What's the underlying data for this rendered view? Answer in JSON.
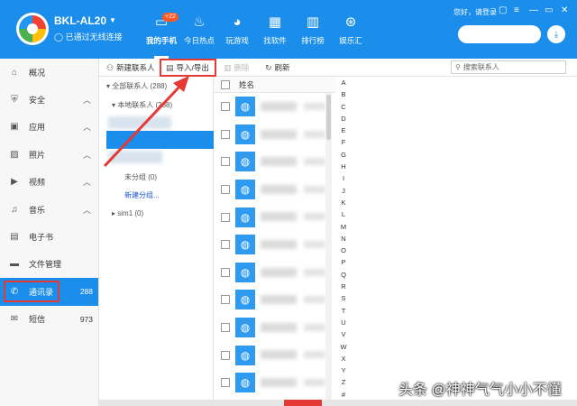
{
  "header": {
    "device_name": "BKL-AL20",
    "device_status": "◯ 已通过无线连接",
    "login_text": "您好，请登录",
    "nav": [
      {
        "label": "我的手机",
        "icon": "phone-icon",
        "badge": "+22"
      },
      {
        "label": "今日热点",
        "icon": "flame-icon"
      },
      {
        "label": "玩游戏",
        "icon": "gamepad-icon"
      },
      {
        "label": "找软件",
        "icon": "apps-grid-icon"
      },
      {
        "label": "排行榜",
        "icon": "bar-chart-icon"
      },
      {
        "label": "娱乐汇",
        "icon": "film-reel-icon"
      }
    ],
    "colors": {
      "primary": "#1a8eea",
      "badge": "#ff5722"
    }
  },
  "sidebar": {
    "items": [
      {
        "label": "概况",
        "icon": "home-icon"
      },
      {
        "label": "安全",
        "icon": "shield-icon",
        "expand": "︿"
      },
      {
        "label": "应用",
        "icon": "app-icon",
        "expand": "︿"
      },
      {
        "label": "照片",
        "icon": "photo-icon",
        "expand": "︿"
      },
      {
        "label": "视频",
        "icon": "video-icon",
        "expand": "︿"
      },
      {
        "label": "音乐",
        "icon": "music-icon",
        "expand": "︿"
      },
      {
        "label": "电子书",
        "icon": "book-icon"
      },
      {
        "label": "文件管理",
        "icon": "folder-icon"
      },
      {
        "label": "通讯录",
        "icon": "phone-handset-icon",
        "count": "288",
        "active": true
      },
      {
        "label": "短信",
        "icon": "sms-icon",
        "count": "973"
      }
    ]
  },
  "toolbar": {
    "new_contact": "新建联系人",
    "import_export": "导入/导出",
    "delete": "删除",
    "refresh": "刷新",
    "search_placeholder": "搜索联系人"
  },
  "groups": {
    "all": "全部联系人 (288)",
    "local": "本地联系人 (288)",
    "ungrouped": "未分组 (0)",
    "new_group": "新建分组...",
    "sim": "sim1 (0)"
  },
  "list": {
    "header": "姓名",
    "rows": 11
  },
  "alphabet": [
    "A",
    "B",
    "C",
    "D",
    "E",
    "F",
    "G",
    "H",
    "I",
    "J",
    "K",
    "L",
    "M",
    "N",
    "O",
    "P",
    "Q",
    "R",
    "S",
    "T",
    "U",
    "V",
    "W",
    "X",
    "Y",
    "Z",
    "#"
  ],
  "watermark": "头条 @神神气气小小不懂",
  "annotation_color": "#e53935"
}
